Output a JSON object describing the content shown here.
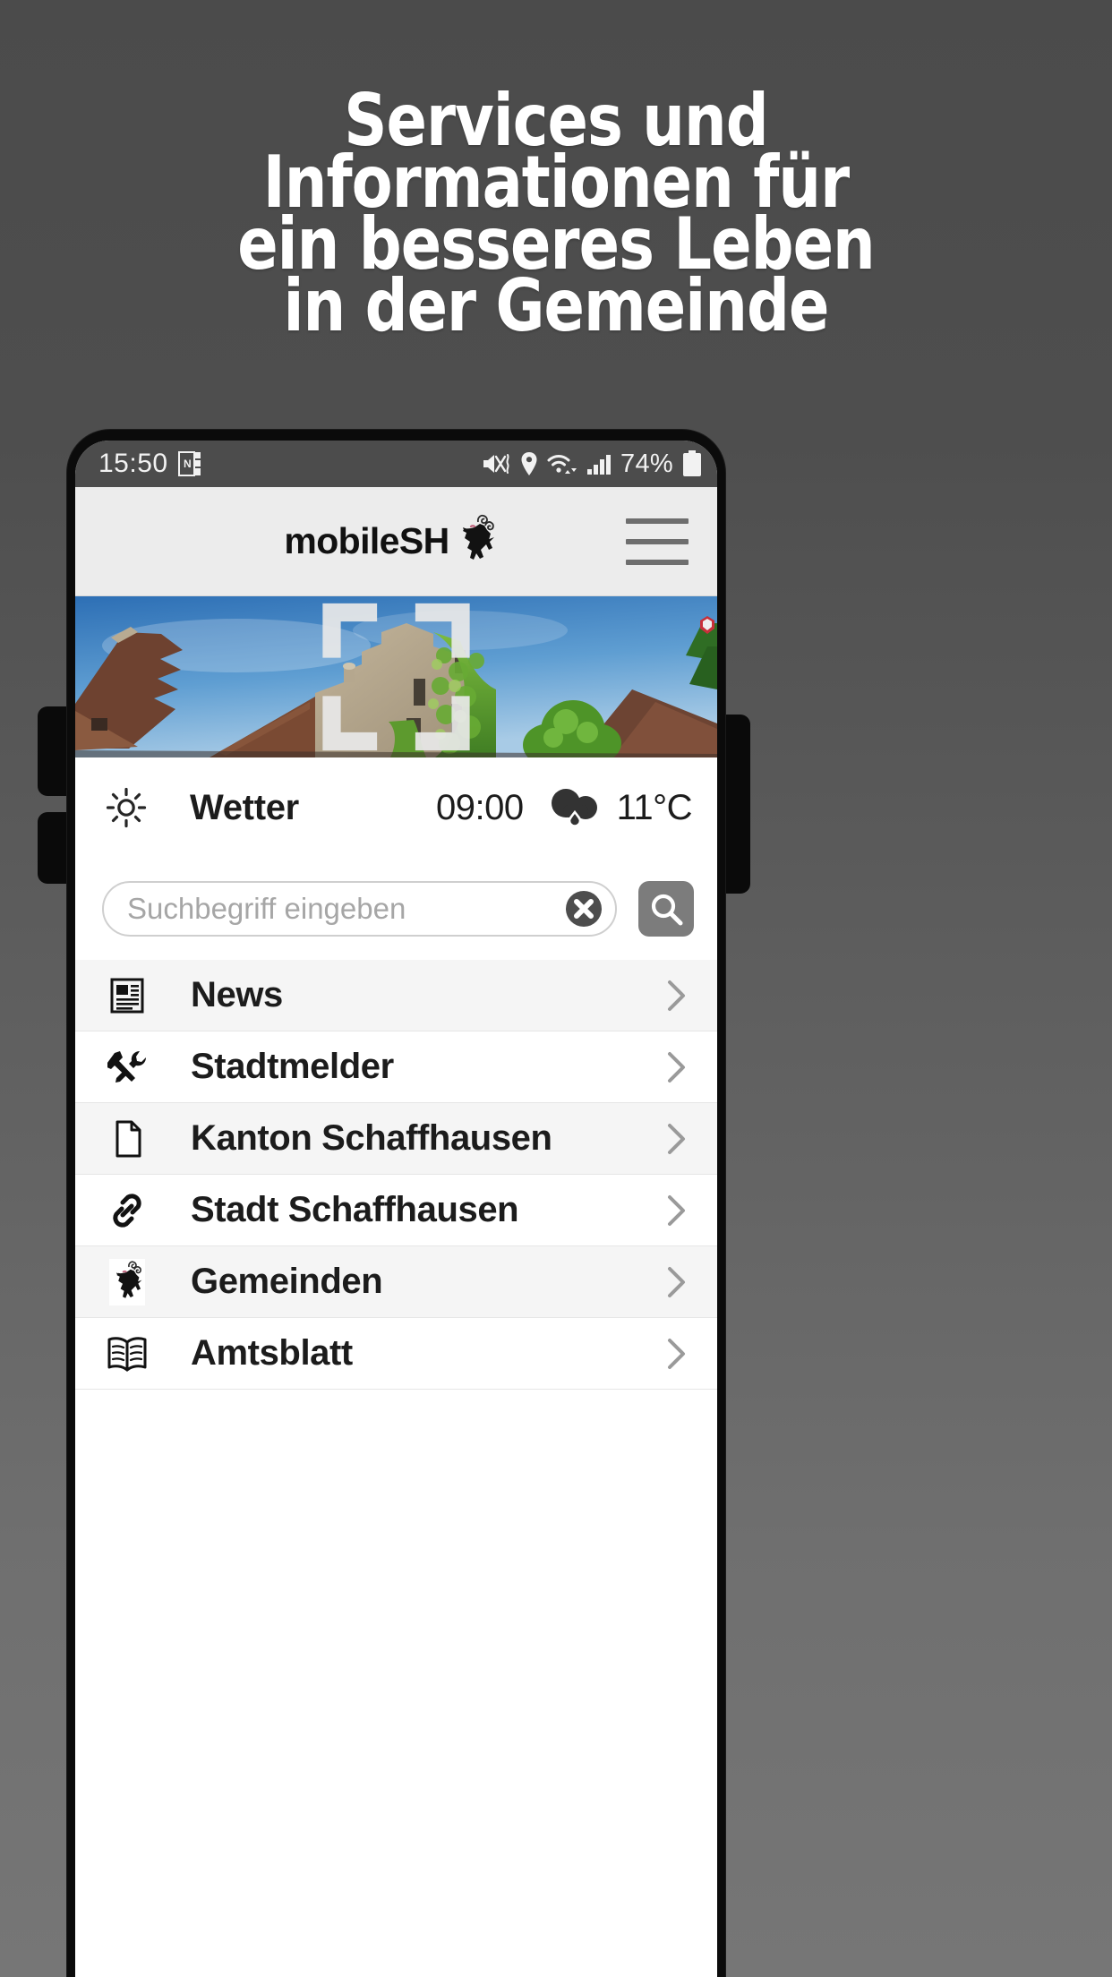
{
  "promo": {
    "headline_lines": [
      "Services und",
      "Informationen für",
      "ein besseres Leben",
      "in der Gemeinde"
    ],
    "background_color": "#4d4d4d",
    "text_color": "#ffffff"
  },
  "status_bar": {
    "time": "15:50",
    "left_icons": [
      "onenote-icon"
    ],
    "right_icons": [
      "mute-vibrate-icon",
      "location-pin-icon",
      "wifi-icon",
      "signal-bars-icon"
    ],
    "battery_percent": "74%",
    "background_color": "#4c4c4c"
  },
  "app_header": {
    "brand_text": "mobileSH",
    "logo_icon": "schaffhausen-ram-icon",
    "menu_icon": "hamburger-menu-icon",
    "background_color": "#ececec"
  },
  "hero": {
    "alt": "Altstadt Schaffhausen Gebaeude mit Efeu",
    "expand_icon": "fullscreen-expand-icon"
  },
  "weather": {
    "icon": "sun-icon",
    "label": "Wetter",
    "time": "09:00",
    "condition_icon": "rain-cloud-icon",
    "temperature": "11°C"
  },
  "search": {
    "placeholder": "Suchbegriff eingeben",
    "value": "",
    "clear_icon": "clear-circle-icon",
    "submit_icon": "search-icon",
    "submit_color": "#7c7c7c"
  },
  "menu": {
    "items": [
      {
        "label": "News",
        "icon": "newspaper-icon",
        "chevron": "chevron-right-icon"
      },
      {
        "label": "Stadtmelder",
        "icon": "tools-icon",
        "chevron": "chevron-right-icon"
      },
      {
        "label": "Kanton Schaffhausen",
        "icon": "document-icon",
        "chevron": "chevron-right-icon"
      },
      {
        "label": "Stadt Schaffhausen",
        "icon": "link-icon",
        "chevron": "chevron-right-icon"
      },
      {
        "label": "Gemeinden",
        "icon": "coat-of-arms-icon",
        "chevron": "chevron-right-icon"
      },
      {
        "label": "Amtsblatt",
        "icon": "open-book-icon",
        "chevron": "chevron-right-icon"
      }
    ]
  },
  "device": {
    "volume_up_button": "volume-up-button",
    "volume_down_button": "volume-down-button",
    "power_button": "power-button"
  }
}
